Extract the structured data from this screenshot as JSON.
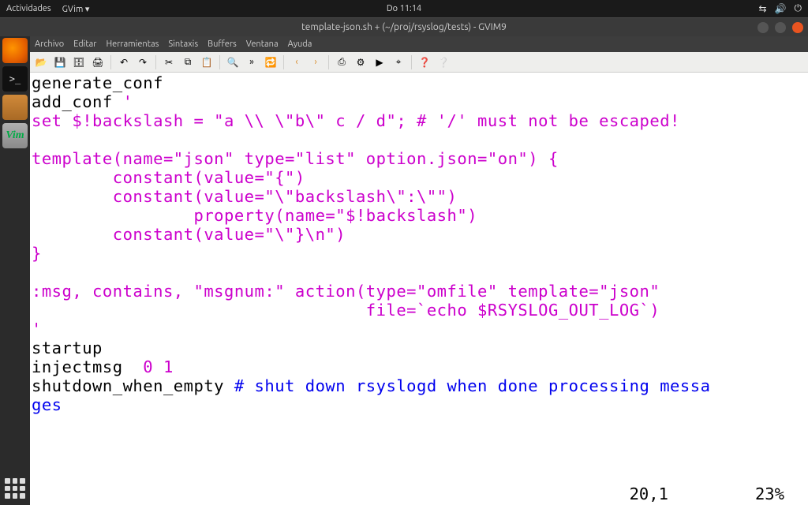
{
  "gnome": {
    "activities": "Actividades",
    "app_menu": "GVim ▾",
    "clock": "Do 11:14",
    "tray": {
      "net": "⇆",
      "vol": "🔊",
      "power": "⏻"
    }
  },
  "window": {
    "title": "template-json.sh + (~/proj/rsyslog/tests) - GVIM9"
  },
  "menu": {
    "items": [
      "Archivo",
      "Editar",
      "Herramientas",
      "Sintaxis",
      "Buffers",
      "Ventana",
      "Ayuda"
    ]
  },
  "toolbar": {
    "open": "📂",
    "save": "💾",
    "saveall": "🗄",
    "print": "🖨",
    "undo": "↶",
    "redo": "↷",
    "cut": "✂",
    "copy": "⧉",
    "paste": "📋",
    "find": "🔍",
    "findnext": "»",
    "replace": "🔁",
    "back": "‹",
    "fwd": "›",
    "script": "⎙",
    "make": "⚙",
    "shell": "▶",
    "tag": "⌖",
    "help": "❓",
    "help2": "❔"
  },
  "code": {
    "l1": "generate_conf",
    "l2a": "add_conf ",
    "l2b": "'",
    "l3": "set $!backslash = \"a \\\\ \\\"b\\\" c / d\"; # '/' must not be escaped!",
    "l4": "",
    "l5": "template(name=\"json\" type=\"list\" option.json=\"on\") {",
    "l6": "        constant(value=\"{\")",
    "l7": "        constant(value=\"\\\"backslash\\\":\\\"\")",
    "l8": "                property(name=\"$!backslash\")",
    "l9": "        constant(value=\"\\\"}\\n\")",
    "l10": "}",
    "l11": "",
    "l12": ":msg, contains, \"msgnum:\" action(type=\"omfile\" template=\"json\"",
    "l13": "                                 file=`echo $RSYSLOG_OUT_LOG`)",
    "l14": "'",
    "l15": "startup",
    "l16a": "injectmsg  ",
    "l16b": "0 1",
    "l17a": "shutdown_when_empty ",
    "l17b": "# shut down rsyslogd when done processing messa",
    "l18": "ges"
  },
  "status": {
    "pos": "20,1",
    "pct": "23%"
  },
  "dock": {
    "firefox": "firefox",
    "terminal": ">_",
    "files": "files",
    "gvim": "Vim"
  }
}
